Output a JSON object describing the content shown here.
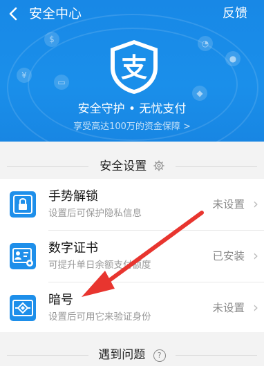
{
  "header": {
    "title": "安全中心",
    "feedback_label": "反馈",
    "tagline": "安全守护 • 无忧支付",
    "subline": "享受高达100万的资金保障 >",
    "shield_glyph": "支",
    "brand_color": "#1a8fea"
  },
  "security_settings": {
    "title": "安全设置",
    "items": [
      {
        "label": "手势解锁",
        "desc": "设置后可保护隐私信息",
        "status": "未设置",
        "icon": "lock-icon"
      },
      {
        "label": "数字证书",
        "desc": "可提升单日余额支付额度",
        "status": "已安装",
        "icon": "certificate-icon"
      },
      {
        "label": "暗号",
        "desc": "设置后可用它来验证身份",
        "status": "未设置",
        "icon": "passcode-icon"
      }
    ]
  },
  "problems": {
    "title": "遇到问题",
    "help_glyph": "?"
  },
  "colors": {
    "annotation_arrow": "#e8352f",
    "chevron": "#bbbbbb"
  }
}
